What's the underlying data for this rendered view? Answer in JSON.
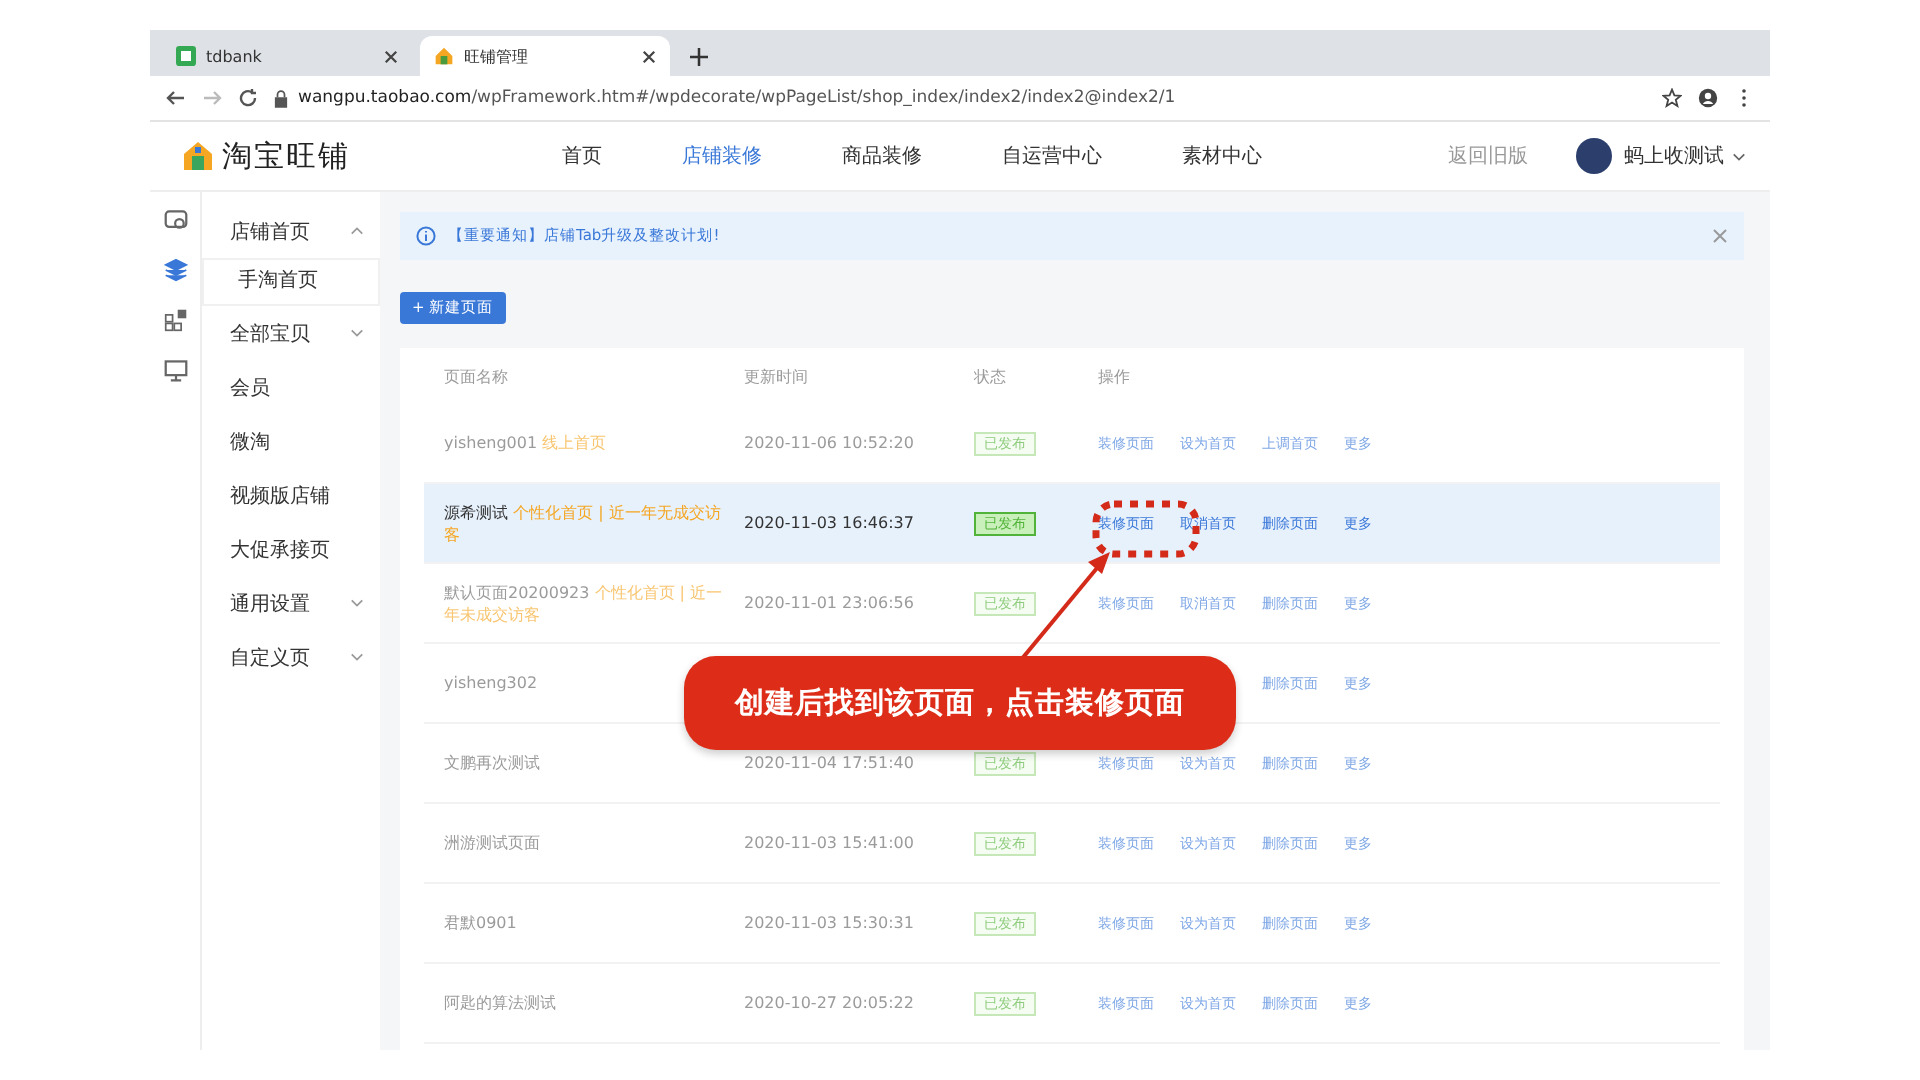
{
  "browser": {
    "tabs": [
      {
        "title": "tdbank",
        "selected": false
      },
      {
        "title": "旺铺管理",
        "selected": true
      }
    ],
    "url_host": "wangpu.taobao.com",
    "url_path": "/wpFramework.htm#/wpdecorate/wpPageList/shop_index/index2/index2@index2/1"
  },
  "header": {
    "logo": "淘宝旺铺",
    "nav": [
      {
        "label": "首页",
        "selected": false
      },
      {
        "label": "店铺装修",
        "selected": true
      },
      {
        "label": "商品装修",
        "selected": false
      },
      {
        "label": "自运营中心",
        "selected": false
      },
      {
        "label": "素材中心",
        "selected": false
      }
    ],
    "back_link": "返回旧版",
    "user": "蚂上收测试"
  },
  "rail": [
    {
      "selected": false
    },
    {
      "selected": true
    },
    {
      "selected": false
    },
    {
      "selected": false
    }
  ],
  "sidebar": {
    "items": [
      {
        "label": "店铺首页",
        "kind": "group",
        "expanded": true,
        "children": [
          {
            "label": "手淘首页",
            "selected": true
          }
        ]
      },
      {
        "label": "全部宝贝",
        "kind": "group",
        "expanded": false
      },
      {
        "label": "会员",
        "kind": "link"
      },
      {
        "label": "微淘",
        "kind": "link"
      },
      {
        "label": "视频版店铺",
        "kind": "link"
      },
      {
        "label": "大促承接页",
        "kind": "link"
      },
      {
        "label": "通用设置",
        "kind": "group",
        "expanded": false
      },
      {
        "label": "自定义页",
        "kind": "group",
        "expanded": false
      }
    ]
  },
  "notice": "【重要通知】店铺Tab升级及整改计划!",
  "new_page_button": "+ 新建页面",
  "table": {
    "columns": [
      "页面名称",
      "更新时间",
      "状态",
      "操作"
    ],
    "rows": [
      {
        "kind": "row",
        "selected": false,
        "name": "yisheng001",
        "label": "线上首页",
        "time": "2020-11-06 10:52:20",
        "status": "已发布",
        "actions": [
          "装修页面",
          "设为首页",
          "上调首页",
          "更多"
        ]
      },
      {
        "kind": "row",
        "selected": true,
        "name": "源希测试",
        "label": "个性化首页 | 近一年无成交访客",
        "time": "2020-11-03 16:46:37",
        "status": "已发布",
        "actions": [
          "装修页面",
          "取消首页",
          "删除页面",
          "更多"
        ]
      },
      {
        "kind": "row",
        "selected": false,
        "name": "默认页面20200923",
        "label": "个性化首页 | 近一年未成交访客",
        "time": "2020-11-01 23:06:56",
        "status": "已发布",
        "actions": [
          "装修页面",
          "取消首页",
          "删除页面",
          "更多"
        ]
      },
      {
        "kind": "callout",
        "selected": false,
        "name": "yisheng302",
        "callout": "创建后找到该页面，点击装修页面",
        "actions": [
          "删除页面",
          "更多"
        ]
      },
      {
        "kind": "row",
        "selected": false,
        "name": "文鹏再次测试",
        "time": "2020-11-04 17:51:40",
        "status": "已发布",
        "actions": [
          "装修页面",
          "设为首页",
          "删除页面",
          "更多"
        ]
      },
      {
        "kind": "row",
        "selected": false,
        "name": "洲游测试页面",
        "time": "2020-11-03 15:41:00",
        "status": "已发布",
        "actions": [
          "装修页面",
          "设为首页",
          "删除页面",
          "更多"
        ]
      },
      {
        "kind": "row",
        "selected": false,
        "name": "君默0901",
        "time": "2020-11-03 15:30:31",
        "status": "已发布",
        "actions": [
          "装修页面",
          "设为首页",
          "删除页面",
          "更多"
        ]
      },
      {
        "kind": "row",
        "selected": false,
        "name": "阿匙的算法测试",
        "time": "2020-10-27 20:05:22",
        "status": "已发布",
        "actions": [
          "装修页面",
          "设为首页",
          "删除页面",
          "更多"
        ]
      }
    ]
  }
}
